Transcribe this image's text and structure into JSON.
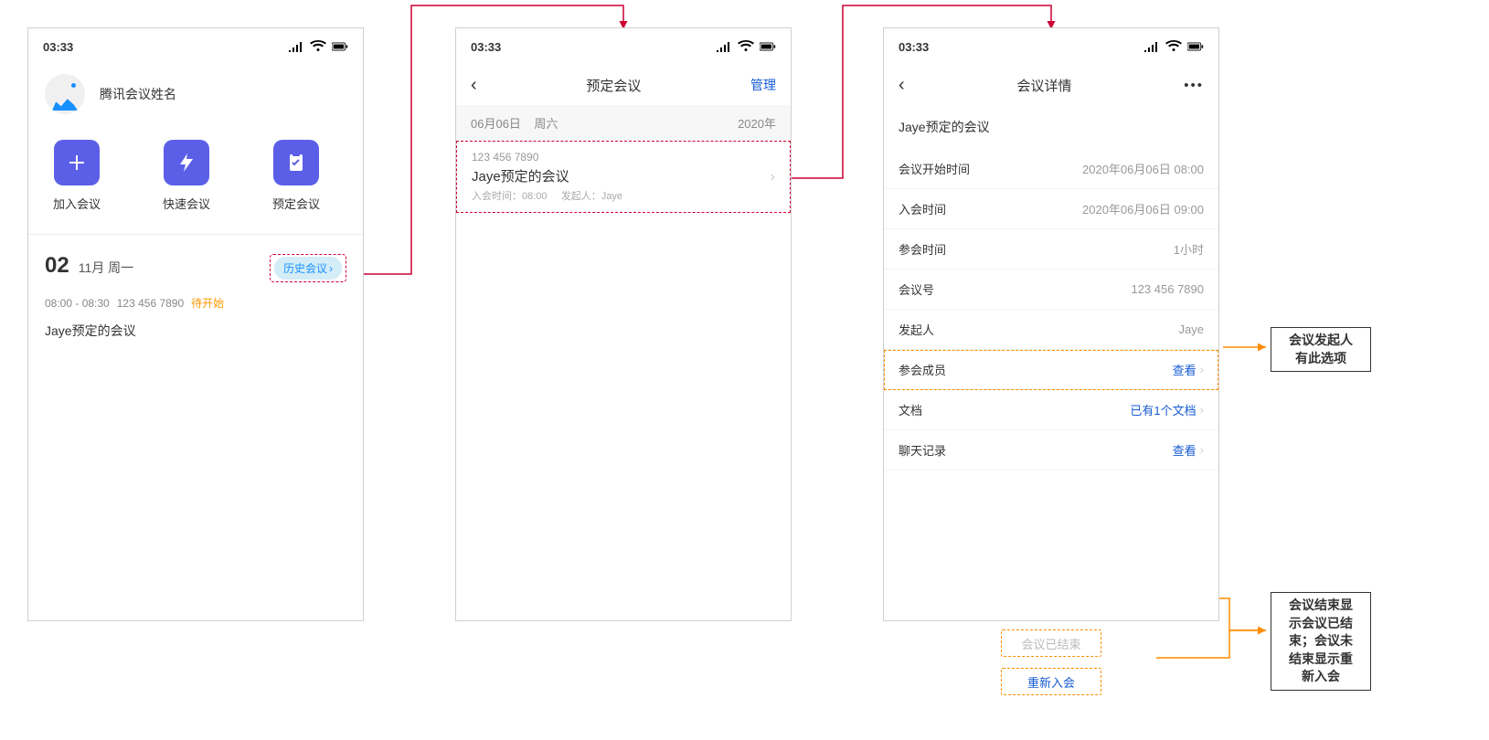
{
  "statusbar": {
    "time": "03:33"
  },
  "screen1": {
    "profile_name": "腾讯会议姓名",
    "actions": {
      "join": "加入会议",
      "quick": "快速会议",
      "schedule": "预定会议"
    },
    "date_num": "02",
    "date_text": "11月 周一",
    "history_label": "历史会议",
    "meeting_time": "08:00 - 08:30",
    "meeting_id": "123 456 7890",
    "meeting_status": "待开始",
    "meeting_title": "Jaye预定的会议"
  },
  "screen2": {
    "nav_title": "预定会议",
    "nav_action": "管理",
    "section_date": "06月06日",
    "section_day": "周六",
    "section_year": "2020年",
    "item_id": "123 456 7890",
    "item_title": "Jaye预定的会议",
    "item_sub_time_label": "入会时间：",
    "item_sub_time": "08:00",
    "item_sub_host_label": "发起人：",
    "item_sub_host": "Jaye"
  },
  "screen3": {
    "nav_title": "会议详情",
    "title": "Jaye预定的会议",
    "rows": {
      "start_label": "会议开始时间",
      "start_value": "2020年06月06日  08:00",
      "join_label": "入会时间",
      "join_value": "2020年06月06日  09:00",
      "duration_label": "参会时间",
      "duration_value": "1小时",
      "id_label": "会议号",
      "id_value": "123 456 7890",
      "host_label": "发起人",
      "host_value": "Jaye",
      "members_label": "参会成员",
      "members_value": "查看",
      "doc_label": "文档",
      "doc_value": "已有1个文档",
      "chat_label": "聊天记录",
      "chat_value": "查看"
    },
    "btn_ended": "会议已结束",
    "btn_rejoin": "重新入会"
  },
  "annotations": {
    "members_note": "会议发起人\n有此选项",
    "footer_note": "会议结束显\n示会议已结\n束；会议未\n结束显示重\n新入会"
  }
}
